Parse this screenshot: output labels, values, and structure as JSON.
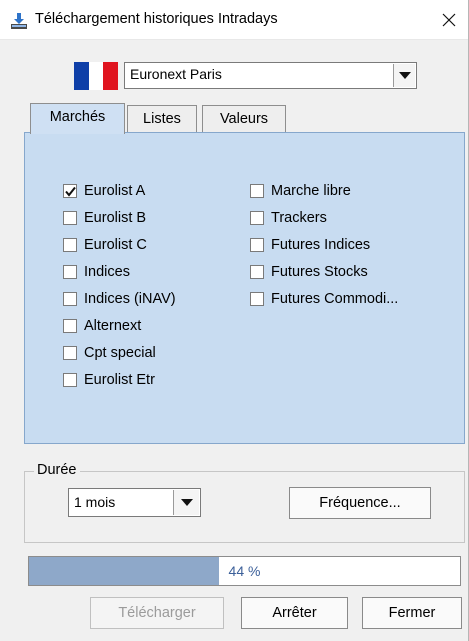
{
  "window": {
    "title": "Téléchargement historiques Intradays",
    "icon": "download-icon",
    "close_icon": "close-icon"
  },
  "market_selector": {
    "flag": "france-flag",
    "flag_colors": [
      "#0e3fa8",
      "#ffffff",
      "#e0141f"
    ],
    "selected": "Euronext Paris"
  },
  "tabs": [
    {
      "label": "Marchés",
      "active": true
    },
    {
      "label": "Listes",
      "active": false
    },
    {
      "label": "Valeurs",
      "active": false
    }
  ],
  "markets_left": [
    {
      "label": "Eurolist A",
      "checked": true
    },
    {
      "label": "Eurolist B",
      "checked": false
    },
    {
      "label": "Eurolist C",
      "checked": false
    },
    {
      "label": "Indices",
      "checked": false
    },
    {
      "label": "Indices (iNAV)",
      "checked": false
    },
    {
      "label": "Alternext",
      "checked": false
    },
    {
      "label": "Cpt special",
      "checked": false
    },
    {
      "label": "Eurolist Etr",
      "checked": false
    }
  ],
  "markets_right": [
    {
      "label": "Marche libre",
      "checked": false
    },
    {
      "label": "Trackers",
      "checked": false
    },
    {
      "label": "Futures Indices",
      "checked": false
    },
    {
      "label": "Futures Stocks",
      "checked": false
    },
    {
      "label": "Futures Commodi...",
      "checked": false
    }
  ],
  "duration": {
    "group_label": "Durée",
    "selected": "1 mois",
    "frequency_button": "Fréquence..."
  },
  "progress": {
    "fraction": 0.44,
    "label": "44 %"
  },
  "buttons": {
    "download": "Télécharger",
    "stop": "Arrêter",
    "close": "Fermer"
  },
  "colors": {
    "panel_bg": "#c8dcf1",
    "progress_fill": "#8ea8c9",
    "progress_text": "#3b5f99"
  }
}
